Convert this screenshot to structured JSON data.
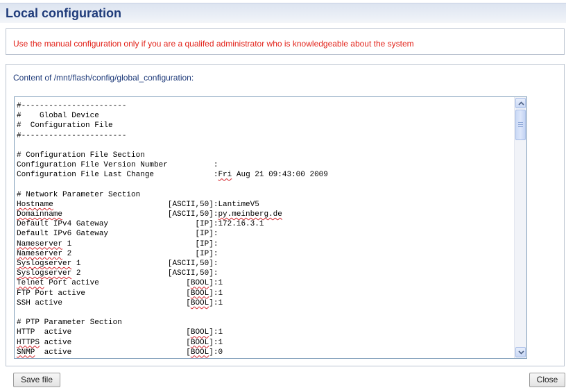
{
  "header": {
    "title": "Local configuration"
  },
  "warning": {
    "text": "Use the manual configuration only if you are a qualifed administrator who is knowledgeable about the system"
  },
  "content": {
    "label": "Content of /mnt/flash/config/global_configuration:",
    "lines": [
      {
        "text": "#-----------------------"
      },
      {
        "text": "#    Global Device"
      },
      {
        "text": "#  Configuration File"
      },
      {
        "text": "#-----------------------"
      },
      {
        "text": ""
      },
      {
        "text": "# Configuration File Section"
      },
      {
        "text": "Configuration File Version Number          :"
      },
      {
        "text": "Configuration File Last Change             :Fri Aug 21 09:43:00 2009",
        "squig": [
          "Fri"
        ]
      },
      {
        "text": ""
      },
      {
        "text": "# Network Parameter Section"
      },
      {
        "text": "Hostname                         [ASCII,50]:LantimeV5",
        "squig": [
          "Hostname"
        ]
      },
      {
        "text": "Domainname                       [ASCII,50]:py.meinberg.de",
        "squig": [
          "Domainname",
          "py.meinberg.de"
        ]
      },
      {
        "text": "Default IPv4 Gateway                   [IP]:172.16.3.1"
      },
      {
        "text": "Default IPv6 Gateway                   [IP]:"
      },
      {
        "text": "Nameserver 1                           [IP]:",
        "squig": [
          "Nameserver"
        ]
      },
      {
        "text": "Nameserver 2                           [IP]:",
        "squig": [
          "Nameserver"
        ]
      },
      {
        "text": "Syslogserver 1                   [ASCII,50]:",
        "squig": [
          "Syslogserver"
        ]
      },
      {
        "text": "Syslogserver 2                   [ASCII,50]:",
        "squig": [
          "Syslogserver"
        ]
      },
      {
        "text": "Telnet Port active                   [BOOL]:1",
        "squig": [
          "Telnet",
          "BOOL"
        ]
      },
      {
        "text": "FTP Port active                      [BOOL]:1",
        "squig": [
          "BOOL"
        ]
      },
      {
        "text": "SSH active                           [BOOL]:1",
        "squig": [
          "BOOL"
        ]
      },
      {
        "text": ""
      },
      {
        "text": "# PTP Parameter Section"
      },
      {
        "text": "HTTP  active                         [BOOL]:1",
        "squig": [
          "BOOL"
        ]
      },
      {
        "text": "HTTPS active                         [BOOL]:1",
        "squig": [
          "HTTPS",
          "BOOL"
        ]
      },
      {
        "text": "SNMP  active                         [BOOL]:0",
        "squig": [
          "SNMP",
          "BOOL"
        ]
      }
    ]
  },
  "buttons": {
    "save": "Save file",
    "close": "Close"
  },
  "icons": {
    "scroll_up": "chevron-up-icon",
    "scroll_down": "chevron-down-icon"
  },
  "colors": {
    "title": "#1f3b7a",
    "warning": "#e2231a",
    "label": "#1f3b7a"
  }
}
